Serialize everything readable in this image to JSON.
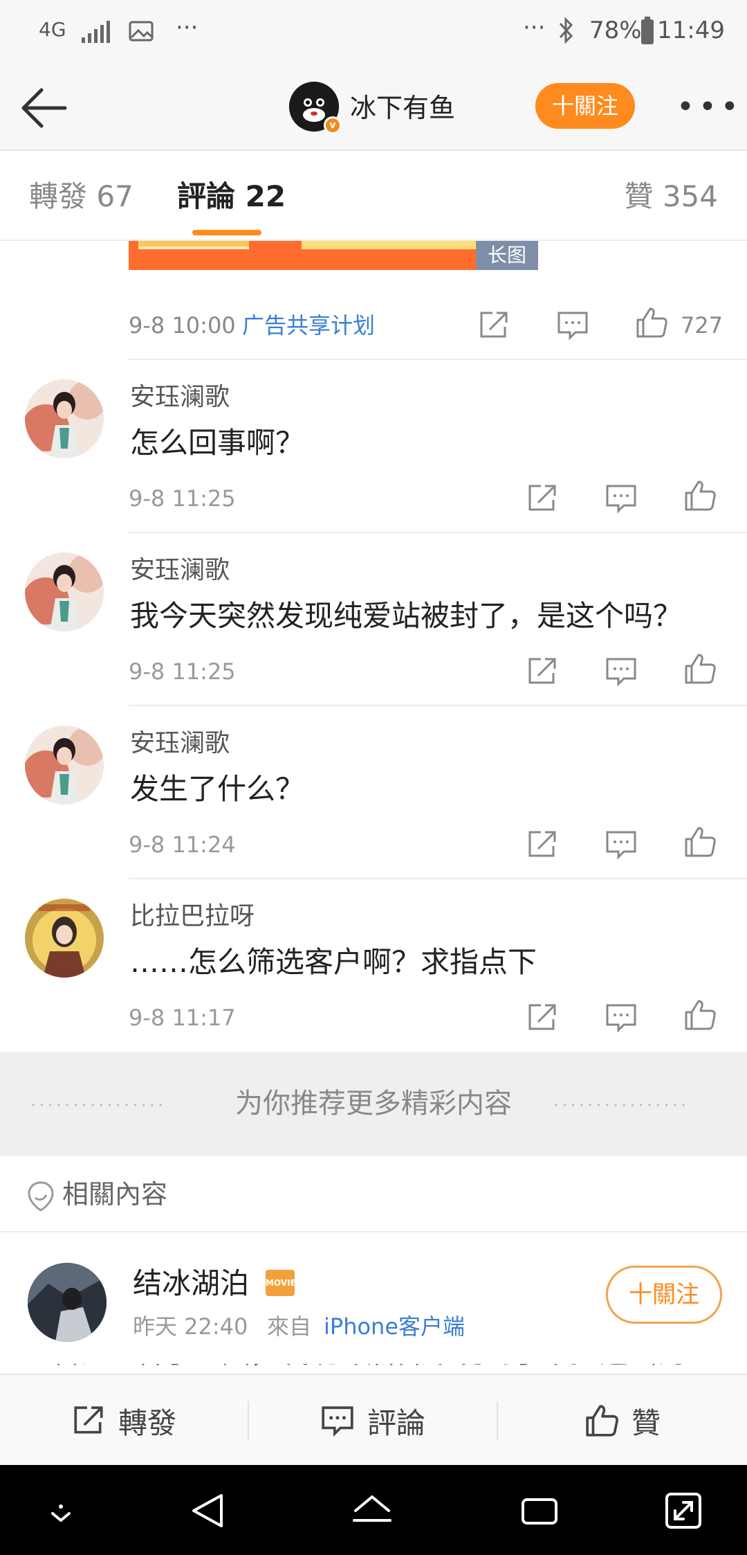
{
  "status_bar": {
    "network": "4G",
    "more": "···",
    "battery": "78%",
    "time": "11:49"
  },
  "header": {
    "name": "冰下有鱼",
    "follow_label": "十關注"
  },
  "tabs": {
    "repost": "轉發 67",
    "comments": "評論 22",
    "likes": "贊 354"
  },
  "ad": {
    "tag": "长图",
    "time": "9-8 10:00",
    "link": "广告共享计划",
    "like_count": "727"
  },
  "comments": [
    {
      "name": "安珏澜歌",
      "text": "怎么回事啊？",
      "time": "9-8 11:25"
    },
    {
      "name": "安珏澜歌",
      "text": "我今天突然发现纯爱站被封了，是这个吗？",
      "time": "9-8 11:25"
    },
    {
      "name": "安珏澜歌",
      "text": "发生了什么？",
      "time": "9-8 11:24"
    },
    {
      "name": "比拉巴拉呀",
      "text": "……怎么筛选客户啊？求指点下",
      "time": "9-8 11:17"
    }
  ],
  "recommend": {
    "text": "为你推荐更多精彩内容",
    "dots": "················"
  },
  "related": {
    "label": "相關內容"
  },
  "related_post": {
    "name": "结冰湖泊",
    "badge": "MOVIE",
    "time": "昨天 22:40",
    "source_prefix": "來自",
    "source": "iPhone客户端",
    "follow_label": "十關注",
    "topic": "#晋江#",
    "text": "看了一圈，发现昨后群今晚到了不少造谣的"
  },
  "action_bar": {
    "repost": "轉發",
    "comment": "評論",
    "like": "贊"
  }
}
